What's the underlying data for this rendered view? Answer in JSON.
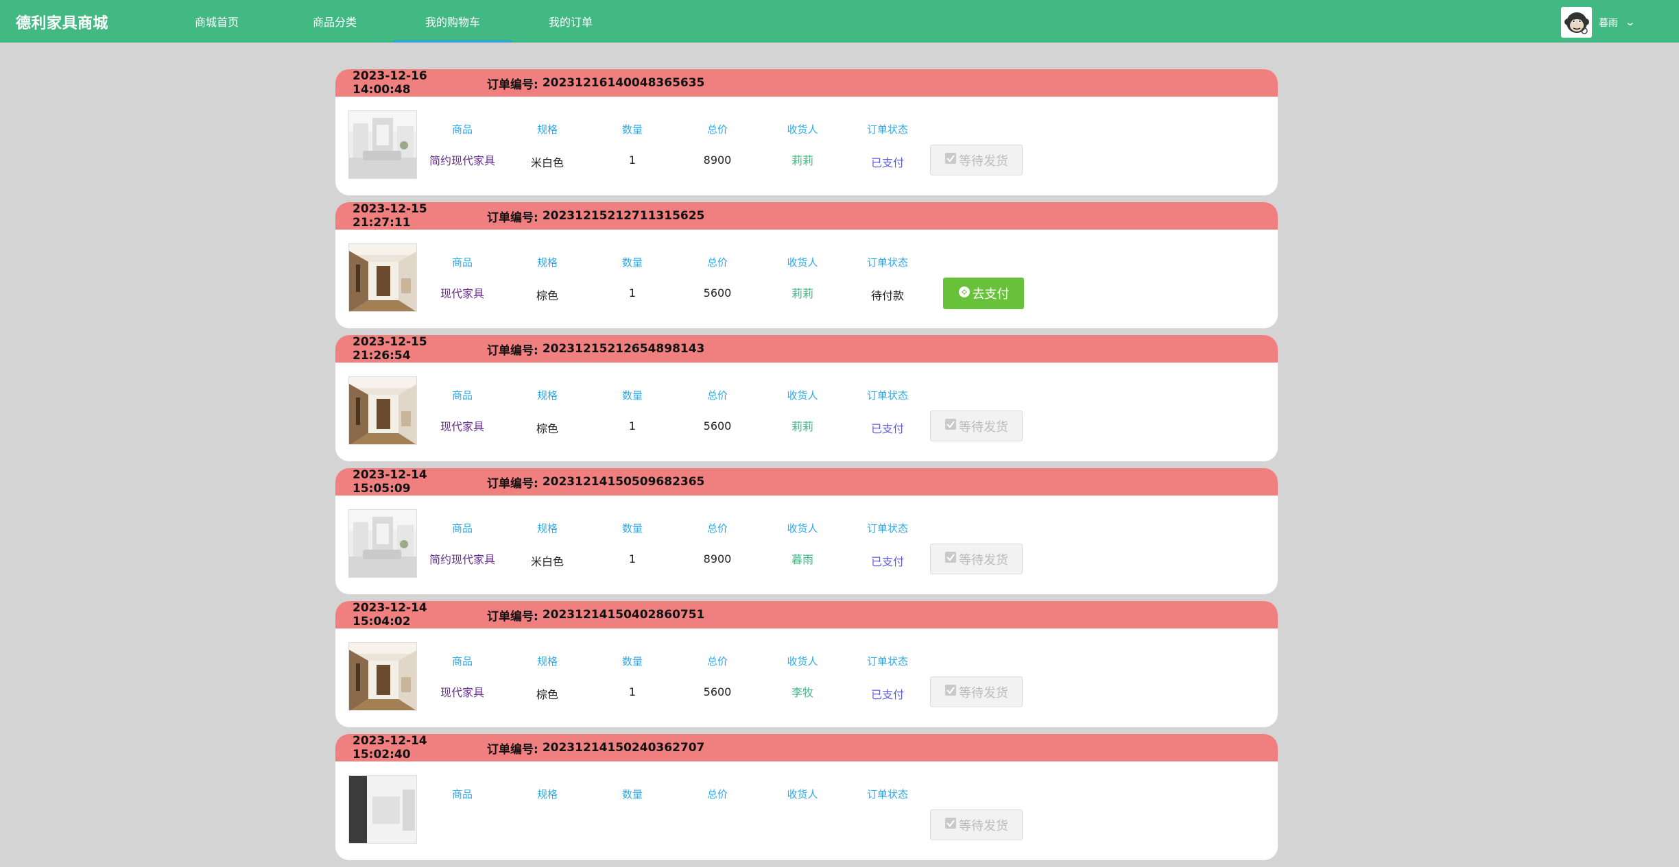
{
  "header": {
    "brand": "德利家具商城",
    "nav": [
      "商城首页",
      "商品分类",
      "我的购物车",
      "我的订单"
    ],
    "active_nav": "我的购物车",
    "user": {
      "name": "暮雨"
    }
  },
  "columns": [
    "商品",
    "规格",
    "数量",
    "总价",
    "收货人",
    "订单状态"
  ],
  "labels": {
    "order_no": "订单编号:",
    "wait_ship": "等待发货",
    "go_pay": "去支付"
  },
  "orders": [
    {
      "date": "2023-12-16 14:00:48",
      "order_no": "20231216140048365635",
      "product": "简约现代家具",
      "spec": "米白色",
      "qty": "1",
      "total": "8900",
      "receiver": "莉莉",
      "status": "已支付",
      "action": "wait",
      "image": "light-room"
    },
    {
      "date": "2023-12-15 21:27:11",
      "order_no": "20231215212711315625",
      "product": "现代家具",
      "spec": "棕色",
      "qty": "1",
      "total": "5600",
      "receiver": "莉莉",
      "status": "待付款",
      "action": "pay",
      "image": "brown-hall"
    },
    {
      "date": "2023-12-15 21:26:54",
      "order_no": "20231215212654898143",
      "product": "现代家具",
      "spec": "棕色",
      "qty": "1",
      "total": "5600",
      "receiver": "莉莉",
      "status": "已支付",
      "action": "wait",
      "image": "brown-hall"
    },
    {
      "date": "2023-12-14 15:05:09",
      "order_no": "20231214150509682365",
      "product": "简约现代家具",
      "spec": "米白色",
      "qty": "1",
      "total": "8900",
      "receiver": "暮雨",
      "status": "已支付",
      "action": "wait",
      "image": "light-room"
    },
    {
      "date": "2023-12-14 15:04:02",
      "order_no": "20231214150402860751",
      "product": "现代家具",
      "spec": "棕色",
      "qty": "1",
      "total": "5600",
      "receiver": "李牧",
      "status": "已支付",
      "action": "wait",
      "image": "brown-hall"
    },
    {
      "date": "2023-12-14 15:02:40",
      "order_no": "20231214150240362707",
      "product": "",
      "spec": "",
      "qty": "",
      "total": "",
      "receiver": "",
      "status": "",
      "action": "wait",
      "image": "dark-room"
    }
  ]
}
